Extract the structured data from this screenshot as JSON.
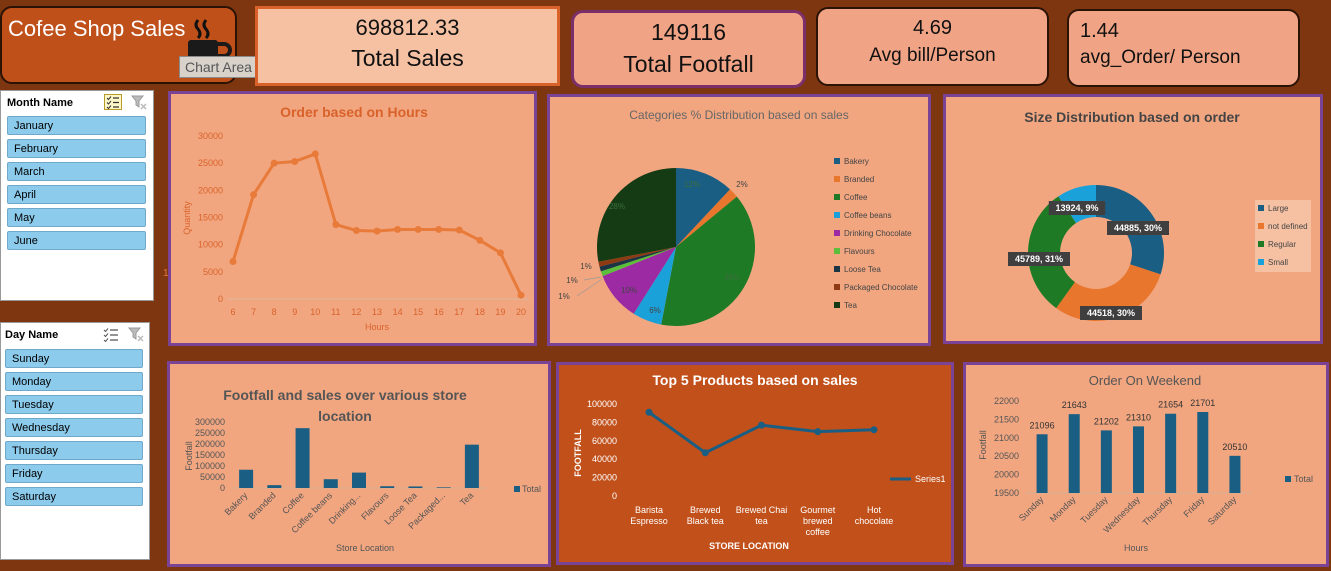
{
  "header": {
    "title": "Cofee  Shop Sales",
    "tooltip": "Chart Area"
  },
  "kpis": {
    "total_sales_value": "698812.33",
    "total_sales_label": "Total Sales",
    "total_footfall_value": "149116",
    "total_footfall_label": "Total Footfall",
    "avg_bill_value": "4.69",
    "avg_bill_label": "Avg bill/Person",
    "avg_order_value": "1.44",
    "avg_order_label": "avg_Order/ Person"
  },
  "slicers": {
    "month": {
      "title": "Month Name",
      "items": [
        "January",
        "February",
        "March",
        "April",
        "May",
        "June"
      ]
    },
    "day": {
      "title": "Day Name",
      "items": [
        "Sunday",
        "Monday",
        "Tuesday",
        "Wednesday",
        "Thursday",
        "Friday",
        "Saturday"
      ]
    }
  },
  "colors": {
    "background": "#7d3610",
    "panel": "#f1a680",
    "panel_border": "#7a4396",
    "orange_line": "#e87a3a",
    "blue": "#1b5e83"
  },
  "chart_data": [
    {
      "id": "hours",
      "type": "line",
      "title": "Order based on Hours",
      "xlabel": "Hours",
      "ylabel": "Quantity",
      "x": [
        6,
        7,
        8,
        9,
        10,
        11,
        12,
        13,
        14,
        15,
        16,
        17,
        18,
        19,
        20
      ],
      "y": [
        6900,
        19200,
        25000,
        25300,
        26700,
        13700,
        12600,
        12500,
        12800,
        12800,
        12800,
        12700,
        10800,
        8500,
        700
      ],
      "yticks": [
        "0",
        "5000",
        "10000",
        "15000",
        "20000",
        "25000",
        "30000"
      ],
      "ylim": [
        0,
        30000
      ],
      "stray_label": "1",
      "grid": false
    },
    {
      "id": "categories",
      "type": "pie",
      "title": "Categories % Distribution  based on sales",
      "labels": [
        "Bakery",
        "Branded",
        "Coffee",
        "Coffee beans",
        "Drinking Chocolate",
        "Flavours",
        "Loose Tea",
        "Packaged Chocolate",
        "Tea"
      ],
      "values": [
        12,
        2,
        39,
        6,
        10,
        1,
        1,
        1,
        28
      ],
      "value_labels": [
        "12%",
        "2%",
        "39%",
        "6%",
        "10%",
        "1%",
        "1%",
        "1%",
        "28%"
      ],
      "colors": [
        "#1b5e83",
        "#e8762d",
        "#1e7a25",
        "#1aa1d9",
        "#9b2aa3",
        "#5cbf3c",
        "#1b3545",
        "#8e3a12",
        "#153b14"
      ],
      "legend": "right"
    },
    {
      "id": "size",
      "type": "donut",
      "title": "Size Distribution based on order",
      "labels": [
        "Large",
        "not defined",
        "Regular",
        "Small"
      ],
      "values": [
        44885,
        44518,
        45789,
        13924
      ],
      "value_labels": [
        "44885, 30%",
        "44518, 30%",
        "45789, 31%",
        "13924, 9%"
      ],
      "colors": [
        "#1b5e83",
        "#e8762d",
        "#1e7a25",
        "#1aa1d9"
      ],
      "legend": "right"
    },
    {
      "id": "location",
      "type": "bar",
      "title_lines": [
        "Footfall and sales over various store",
        "location"
      ],
      "xlabel": "Store Location",
      "ylabel": "Footfall",
      "categories": [
        "Bakery",
        "Branded",
        "Coffee",
        "Coffee beans",
        "Drinking...",
        "Flavours",
        "Loose Tea",
        "Packaged...",
        "Tea"
      ],
      "values": [
        83000,
        13000,
        272000,
        40000,
        70000,
        8000,
        7000,
        3000,
        197000
      ],
      "yticks": [
        "0",
        "50000",
        "100000",
        "150000",
        "200000",
        "250000",
        "300000"
      ],
      "ylim": [
        0,
        300000
      ],
      "series_name": "Total",
      "legend": "right"
    },
    {
      "id": "products",
      "type": "line",
      "title": "Top 5 Products based on sales",
      "xlabel": "STORE LOCATION",
      "ylabel": "FOOTFALL",
      "categories": [
        [
          "Barista",
          "Espresso"
        ],
        [
          "Brewed",
          "Black tea"
        ],
        [
          "Brewed Chai",
          "tea"
        ],
        [
          "Gourmet",
          "brewed",
          "coffee"
        ],
        [
          "Hot",
          "chocolate"
        ]
      ],
      "values": [
        91000,
        47000,
        77000,
        70000,
        72000
      ],
      "yticks": [
        "0",
        "20000",
        "40000",
        "60000",
        "80000",
        "100000"
      ],
      "ylim": [
        0,
        100000
      ],
      "series_name": "Series1",
      "legend": "right"
    },
    {
      "id": "weekend",
      "type": "bar",
      "title": "Order On Weekend",
      "xlabel": "Hours",
      "ylabel": "Footfall",
      "categories": [
        "Sunday",
        "Monday",
        "Tuesday",
        "Wednesday",
        "Thursday",
        "Friday",
        "Saturday"
      ],
      "values": [
        21096,
        21643,
        21202,
        21310,
        21654,
        21701,
        20510
      ],
      "value_labels": [
        "21096",
        "21643",
        "21202",
        "21310",
        "21654",
        "21701",
        "20510"
      ],
      "yticks": [
        "19500",
        "20000",
        "20500",
        "21000",
        "21500",
        "22000"
      ],
      "ylim": [
        19500,
        22000
      ],
      "series_name": "Total",
      "legend": "right"
    }
  ]
}
